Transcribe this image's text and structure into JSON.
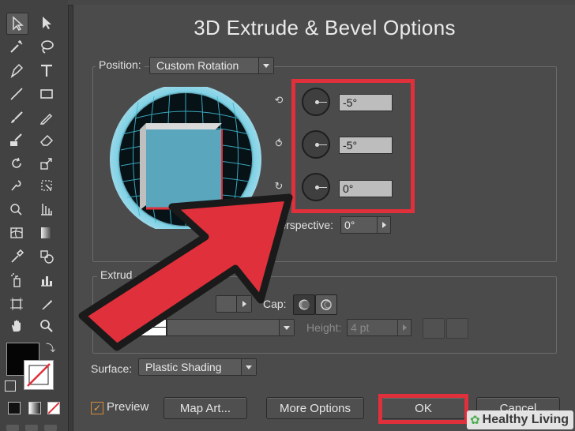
{
  "dialog": {
    "title": "3D Extrude & Bevel Options",
    "position": {
      "label": "Position:",
      "preset": "Custom Rotation",
      "rotation_x": "-5°",
      "rotation_y": "-5°",
      "rotation_z": "0°",
      "perspective_label": "Perspective:",
      "perspective_value": "0°"
    },
    "extrude": {
      "group_label": "Extrud",
      "cap_label": "Cap:",
      "height_label": "Height:",
      "height_value": "4 pt"
    },
    "surface": {
      "label": "Surface:",
      "value": "Plastic Shading"
    },
    "preview": {
      "label": "Preview",
      "checked": true
    },
    "buttons": {
      "map_art": "Map Art...",
      "more_options": "More Options",
      "ok": "OK",
      "cancel": "Cancel"
    }
  },
  "watermark": {
    "text": "Healthy Living"
  },
  "colors": {
    "highlight": "#e0303b",
    "cube_face": "#5aa7bd",
    "dialog_bg": "#4b4b4b",
    "toolbar_bg": "#424242"
  },
  "tools": [
    "selection-icon",
    "direct-selection-icon",
    "magic-wand-icon",
    "lasso-icon",
    "pen-icon",
    "type-icon",
    "line-icon",
    "rectangle-icon",
    "paintbrush-icon",
    "pencil-icon",
    "blob-brush-icon",
    "eraser-icon",
    "rotate-icon",
    "scale-icon",
    "warp-icon",
    "free-transform-icon",
    "shape-builder-icon",
    "perspective-grid-icon",
    "mesh-icon",
    "gradient-icon",
    "eyedropper-icon",
    "blend-icon",
    "symbol-sprayer-icon",
    "column-graph-icon",
    "artboard-icon",
    "slice-icon",
    "hand-icon",
    "zoom-icon"
  ]
}
